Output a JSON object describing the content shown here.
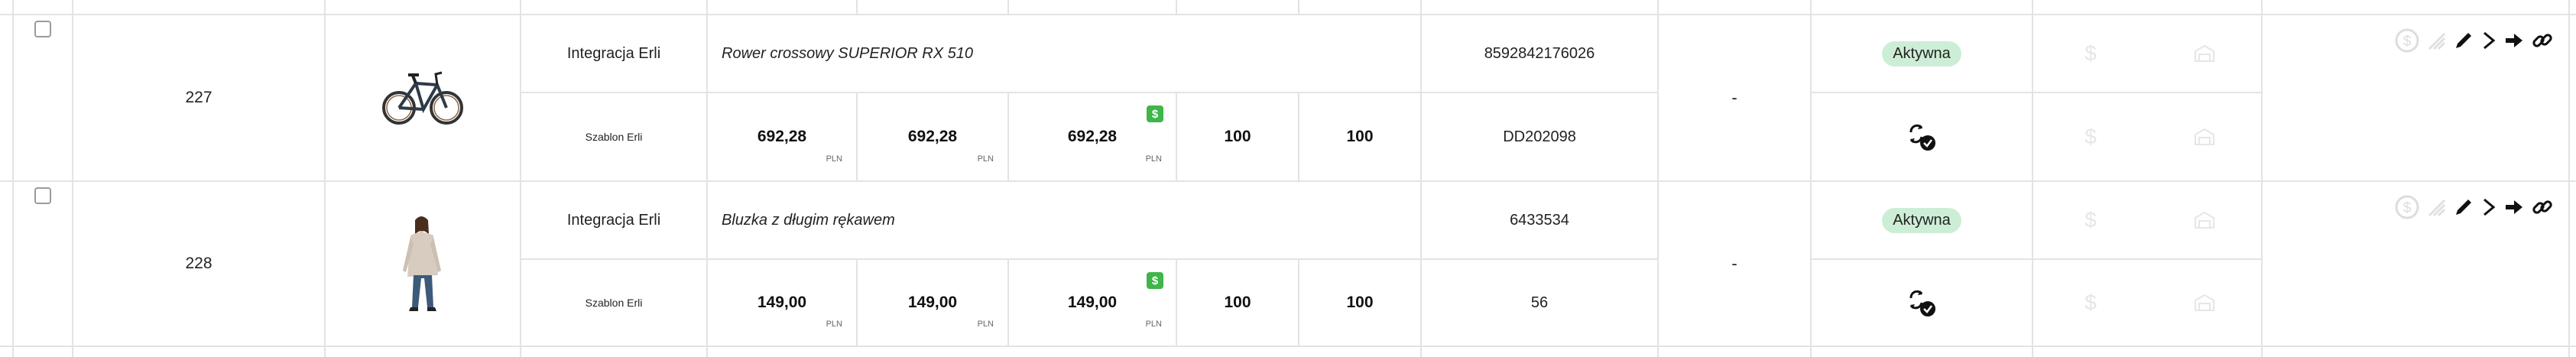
{
  "rows": [
    {
      "id": "227",
      "integration": "Integracja Erli",
      "template": "Szablon Erli",
      "name": "Rower crossowy SUPERIOR RX 510",
      "ean": "8592842176026",
      "sku": "DD202098",
      "price1": "692,28",
      "price2": "692,28",
      "price3": "692,28",
      "currency": "PLN",
      "qty1": "100",
      "qty2": "100",
      "dash": "-",
      "status": "Aktywna",
      "image": "bicycle"
    },
    {
      "id": "228",
      "integration": "Integracja Erli",
      "template": "Szablon Erli",
      "name": "Bluzka z długim rękawem",
      "ean": "6433534",
      "sku": "56",
      "price1": "149,00",
      "price2": "149,00",
      "price3": "149,00",
      "currency": "PLN",
      "qty1": "100",
      "qty2": "100",
      "dash": "-",
      "status": "Aktywna",
      "image": "woman-in-blouse"
    }
  ],
  "icons": {
    "price_badge": "dollar-sign",
    "sync": "sync-check-icon",
    "actions": [
      "dollar-circle-icon",
      "signal-icon",
      "edit-icon",
      "chevron-right-icon",
      "arrow-right-icon",
      "link-icon"
    ],
    "faint": [
      "dollar-icon",
      "warehouse-icon"
    ]
  },
  "colors": {
    "badge_bg": "#cdeed6",
    "price_badge": "#3fb54a",
    "grid": "#e3e3e3"
  }
}
